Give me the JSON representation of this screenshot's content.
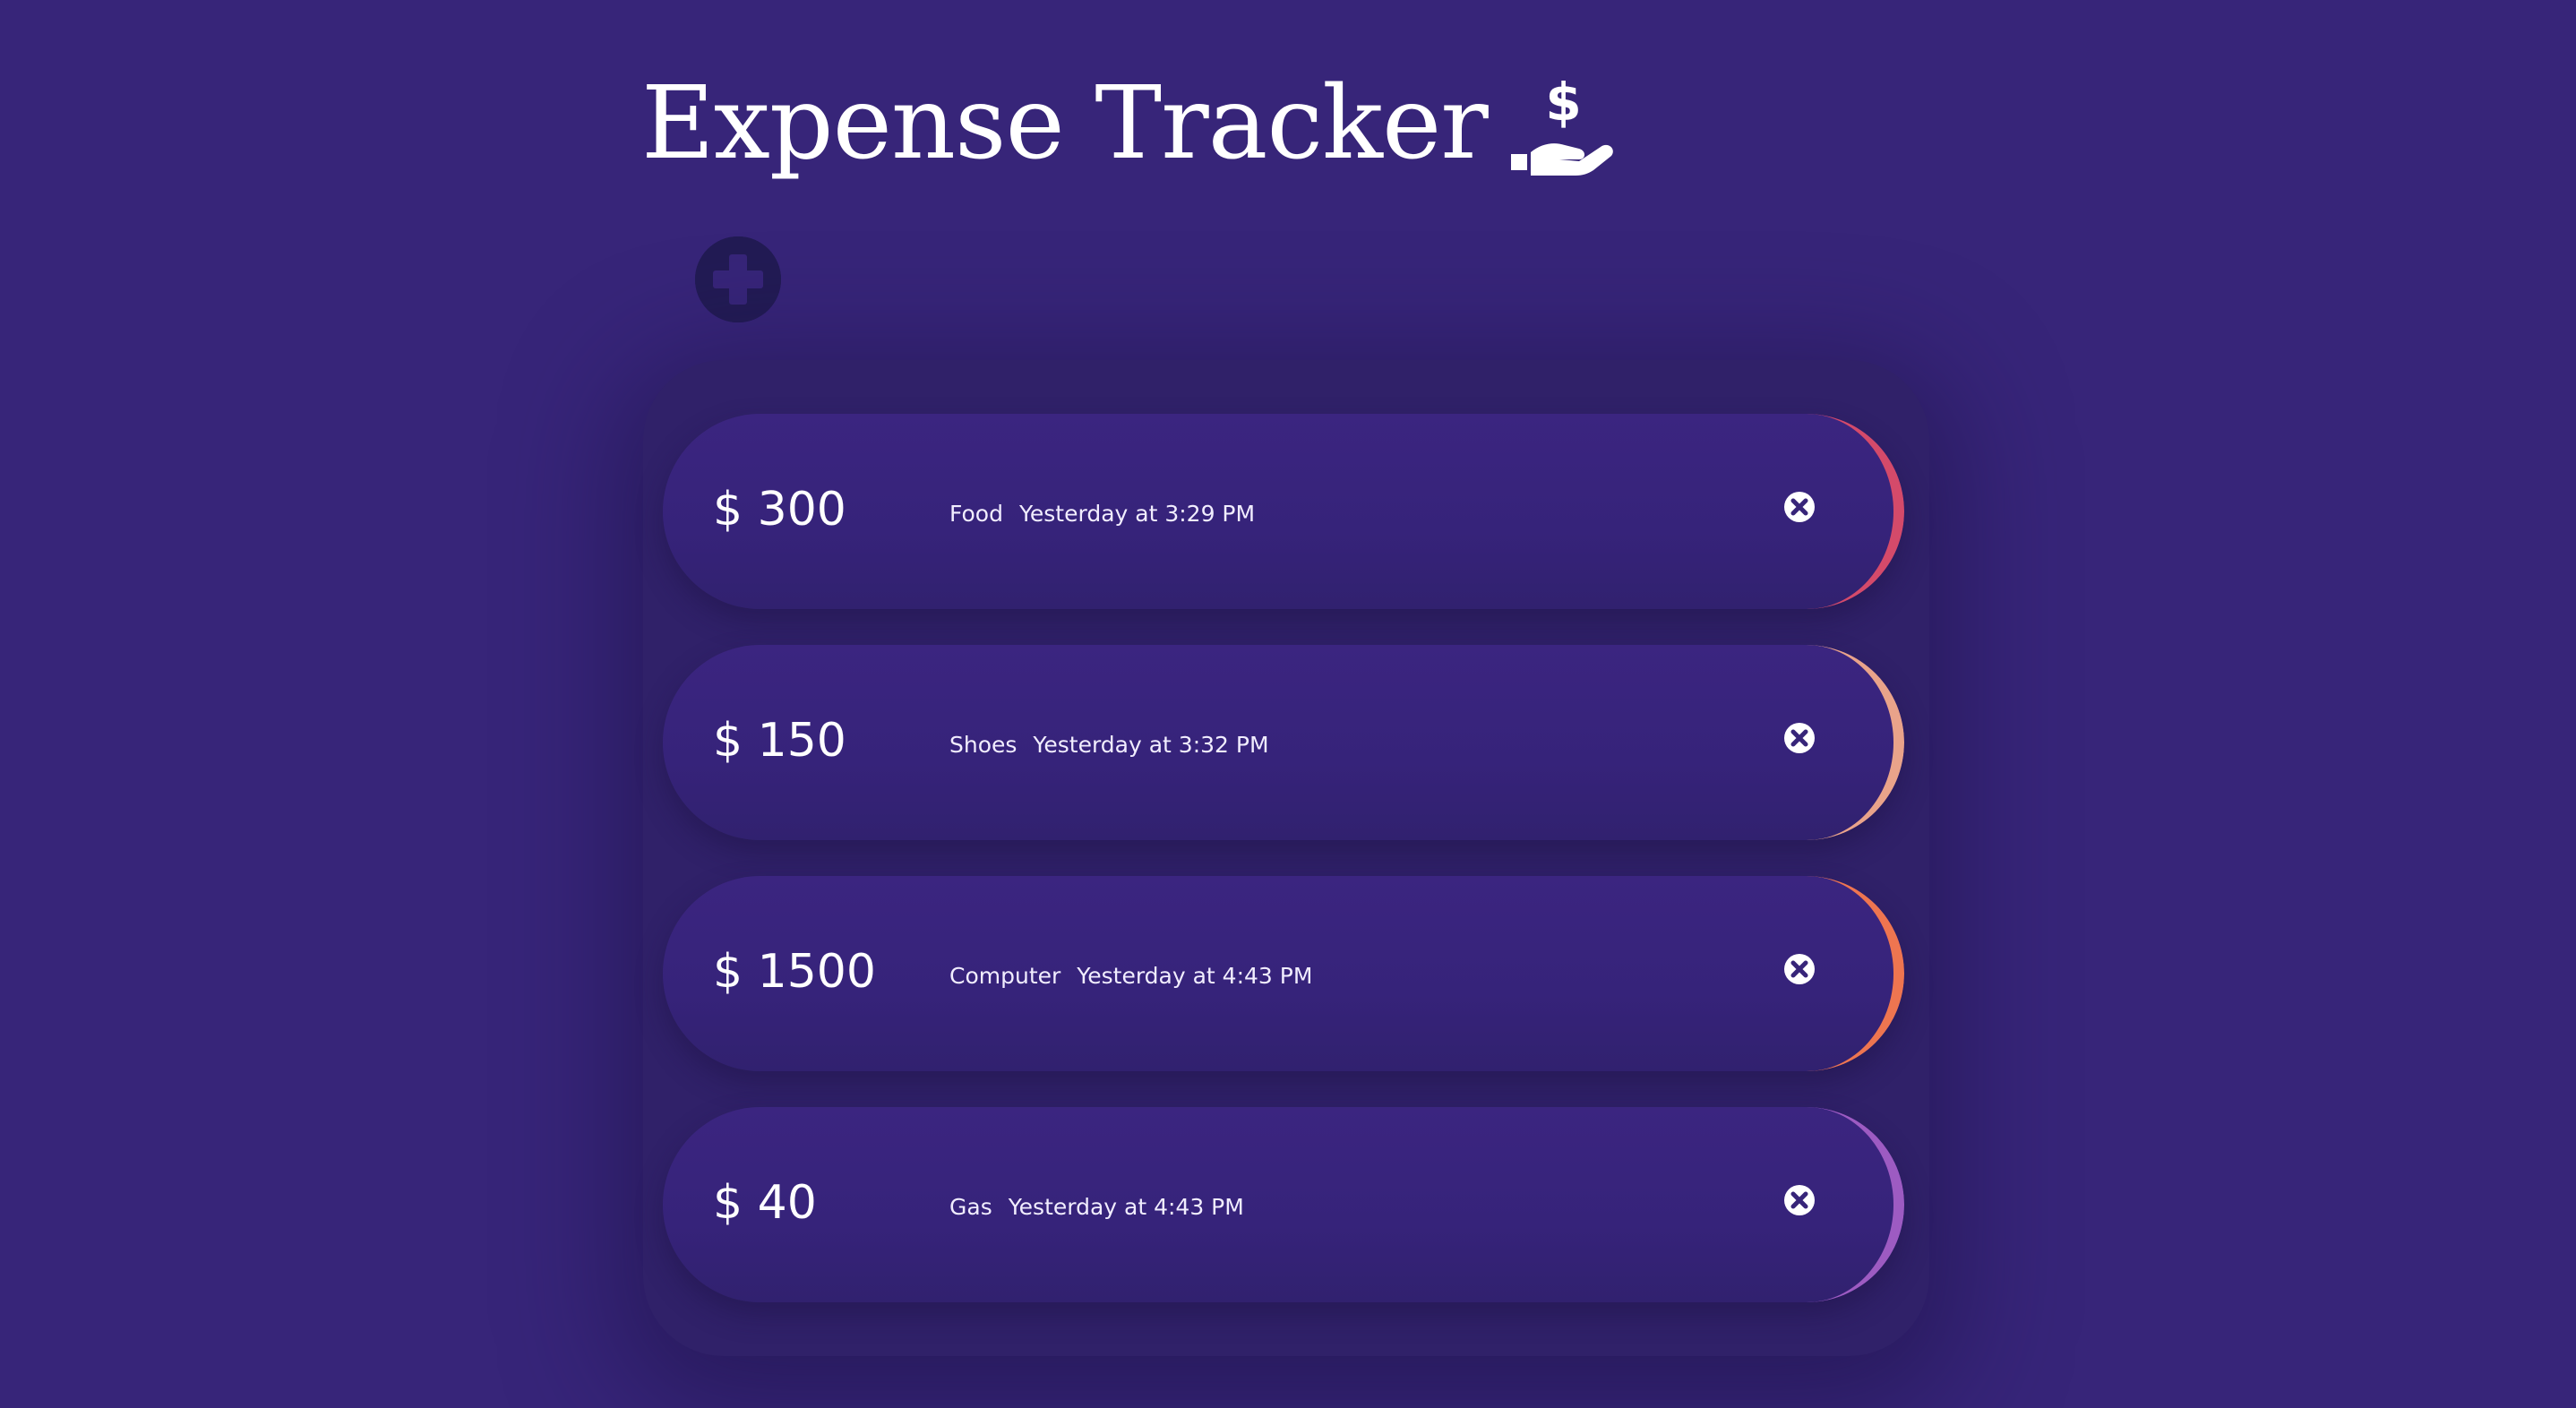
{
  "app": {
    "title": "Expense Tracker",
    "title_icon": "hand-holding-dollar-icon",
    "add_button_icon": "plus-circle-icon"
  },
  "colors": {
    "background": "#372579",
    "panel": "#302169",
    "add_button": "#221b54"
  },
  "expenses": [
    {
      "amount": "$ 300",
      "category": "Food",
      "date": "Yesterday at 3:29 PM",
      "accent": "#d44a6a",
      "delete_icon": "close-circle-icon"
    },
    {
      "amount": "$ 150",
      "category": "Shoes",
      "date": "Yesterday at 3:32 PM",
      "accent": "#e9a38a",
      "delete_icon": "close-circle-icon"
    },
    {
      "amount": "$ 1500",
      "category": "Computer",
      "date": "Yesterday at 4:43 PM",
      "accent": "#ee7550",
      "delete_icon": "close-circle-icon"
    },
    {
      "amount": "$ 40",
      "category": "Gas",
      "date": "Yesterday at 4:43 PM",
      "accent": "#9d5bc2",
      "delete_icon": "close-circle-icon"
    }
  ]
}
